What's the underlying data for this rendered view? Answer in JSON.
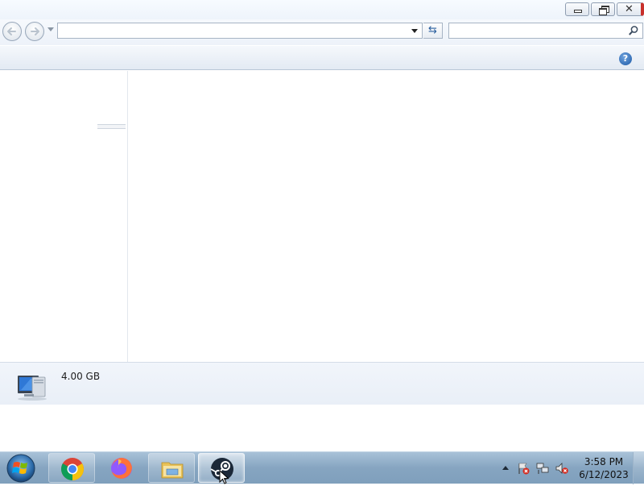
{
  "window": {
    "minimize_icon": "minimize-icon",
    "maximize_icon": "restore-icon",
    "close_icon": "close-icon",
    "close_glyph": "✕"
  },
  "navigation": {
    "back_icon": "back-arrow-icon",
    "forward_icon": "forward-arrow-icon",
    "address_value": "",
    "refresh_glyph": "⇆",
    "search_value": ""
  },
  "commandbar": {
    "help_glyph": "?"
  },
  "details": {
    "icon": "computer-icon",
    "memory": "4.00 GB"
  },
  "taskbar": {
    "start_icon": "windows-start-icon",
    "pinned": [
      {
        "name": "chrome-icon"
      },
      {
        "name": "firefox-icon"
      },
      {
        "name": "file-explorer-icon"
      },
      {
        "name": "steam-icon"
      }
    ],
    "tray": [
      {
        "name": "show-hidden-icons"
      },
      {
        "name": "action-center-flag-icon"
      },
      {
        "name": "network-icon"
      },
      {
        "name": "volume-muted-icon"
      }
    ],
    "clock_time": "3:58 PM",
    "clock_date": "6/12/2023"
  },
  "colors": {
    "accent": "#1d5aa6",
    "close_red": "#c8302b",
    "taskbar": "#86a5c1"
  }
}
